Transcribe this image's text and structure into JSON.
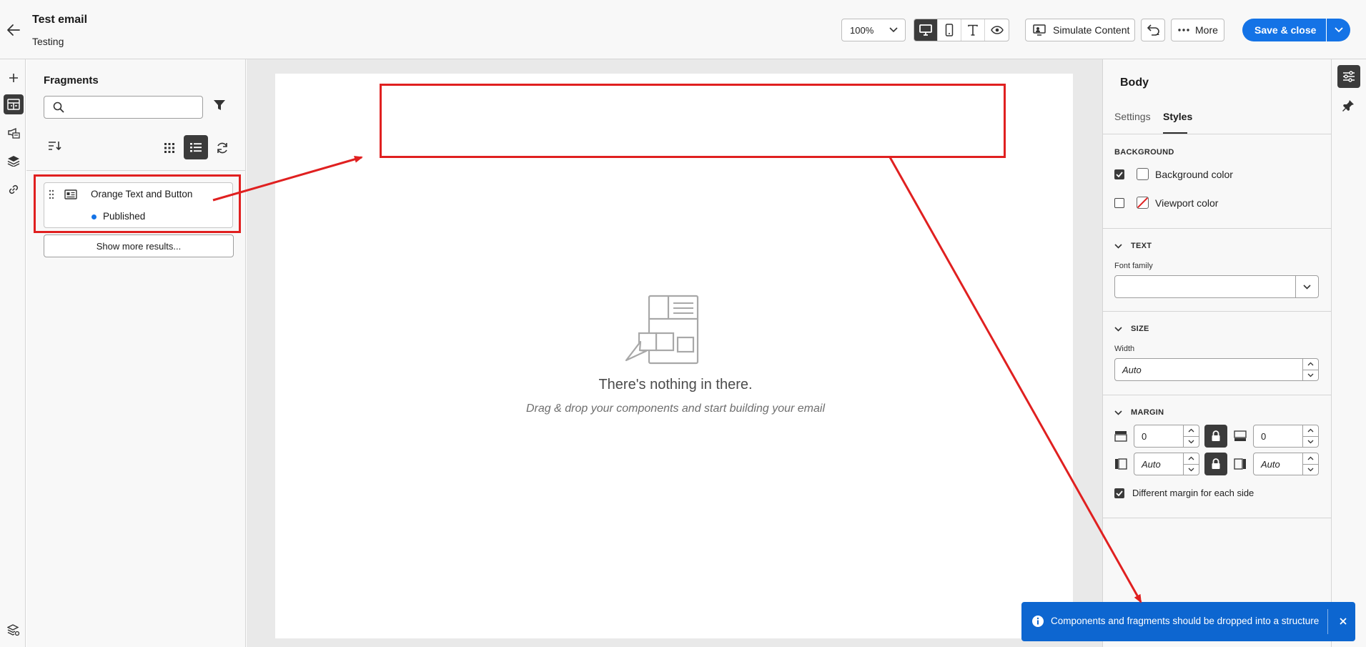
{
  "header": {
    "title": "Test email",
    "subtitle": "Testing",
    "zoom": "100%",
    "simulate_label": "Simulate Content",
    "more_label": "More",
    "save_label": "Save & close"
  },
  "fragments_panel": {
    "title": "Fragments",
    "search_placeholder": "",
    "items": [
      {
        "name": "Orange Text and Button",
        "status": "Published"
      }
    ],
    "show_more_label": "Show more results..."
  },
  "canvas": {
    "empty_title": "There's nothing in there.",
    "empty_desc": "Drag & drop your components and start building your email"
  },
  "properties": {
    "title": "Body",
    "tabs": [
      "Settings",
      "Styles"
    ],
    "active_tab": "Styles",
    "background": {
      "heading": "BACKGROUND",
      "background_color_label": "Background color",
      "viewport_color_label": "Viewport color"
    },
    "text": {
      "heading": "TEXT",
      "font_family_label": "Font family",
      "font_family_value": ""
    },
    "size": {
      "heading": "SIZE",
      "width_label": "Width",
      "width_value": "Auto"
    },
    "margin": {
      "heading": "MARGIN",
      "top": "0",
      "bottom": "0",
      "left": "Auto",
      "right": "Auto",
      "different_margin_label": "Different margin for each side"
    }
  },
  "toast": {
    "message": "Components and fragments should be dropped into a structure"
  },
  "colors": {
    "accent": "#1473e6",
    "annotation": "#e02020",
    "dark": "#3b3b3b"
  }
}
